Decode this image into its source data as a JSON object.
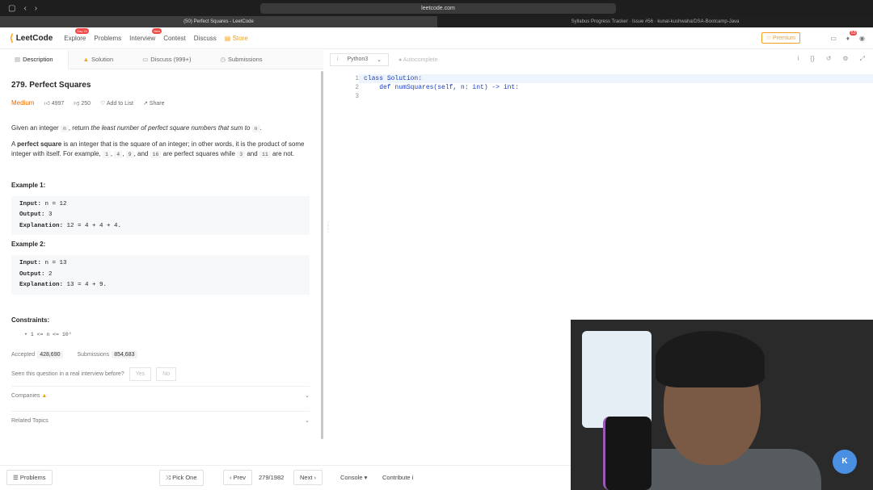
{
  "browser": {
    "url": "leetcode.com",
    "active_tab": "(50) Perfect Squares - LeetCode",
    "other_tab": "Syllabus Progress Tracker · Issue #56 · kunal-kushwaha/DSA-Bootcamp-Java"
  },
  "nav": {
    "logo": "LeetCode",
    "explore": "Explore",
    "explore_badge": "Day 24",
    "problems": "Problems",
    "interview": "Interview",
    "interview_badge": "New",
    "contest": "Contest",
    "discuss": "Discuss",
    "store": "Store",
    "premium": "Premium",
    "notif_count": "53"
  },
  "left_tabs": {
    "description": "Description",
    "solution": "Solution",
    "discuss": "Discuss (999+)",
    "submissions": "Submissions"
  },
  "problem": {
    "title": "279. Perfect Squares",
    "difficulty": "Medium",
    "likes": "4997",
    "dislikes": "250",
    "add_to_list": "Add to List",
    "share": "Share",
    "p1a": "Given an integer ",
    "p1code": "n",
    "p1b": ", return ",
    "p1c": "the least number of perfect square numbers that sum to",
    "p1code2": "n",
    "p1d": ".",
    "p2a": "A ",
    "p2b": "perfect square",
    "p2c": " is an integer that is the square of an integer; in other words, it is the product of some integer with itself. For example, ",
    "c1": "1",
    "c4": "4",
    "c9": "9",
    "c16": "16",
    "c3": "3",
    "c11": "11",
    "and": ", and ",
    "comma": ", ",
    "are_perfect": " are perfect squares while ",
    "and2": " and",
    "are_not": " are not.",
    "example1_title": "Example 1:",
    "example1_input_label": "Input:",
    "example1_input": " n = 12",
    "example1_output_label": "Output:",
    "example1_output": " 3",
    "example1_expl_label": "Explanation:",
    "example1_expl": " 12 = 4 + 4 + 4.",
    "example2_title": "Example 2:",
    "example2_input_label": "Input:",
    "example2_input": " n = 13",
    "example2_output_label": "Output:",
    "example2_output": " 2",
    "example2_expl_label": "Explanation:",
    "example2_expl": " 13 = 4 + 9.",
    "constraints_title": "Constraints:",
    "constraint": "1 <= n <= 10⁴",
    "accepted_label": "Accepted",
    "accepted": "428,690",
    "submissions_label": "Submissions",
    "submissions": "854,683",
    "seen_q": "Seen this question in a real interview before?",
    "yes": "Yes",
    "no": "No",
    "companies": "Companies",
    "related": "Related Topics"
  },
  "editor": {
    "language": "Python3",
    "autocomplete": "Autocomplete",
    "lines": [
      "1",
      "2",
      "3"
    ],
    "code_l1_kw": "class",
    "code_l1_rest": " Solution:",
    "code_l2_indent": "    ",
    "code_l2_kw": "def",
    "code_l2_rest": " numSquares(self, n: int) -> int:"
  },
  "footer": {
    "problems": "Problems",
    "pick_one": "Pick One",
    "prev": "Prev",
    "page": "279/1982",
    "next": "Next",
    "console": "Console",
    "contribute": "Contribute"
  }
}
